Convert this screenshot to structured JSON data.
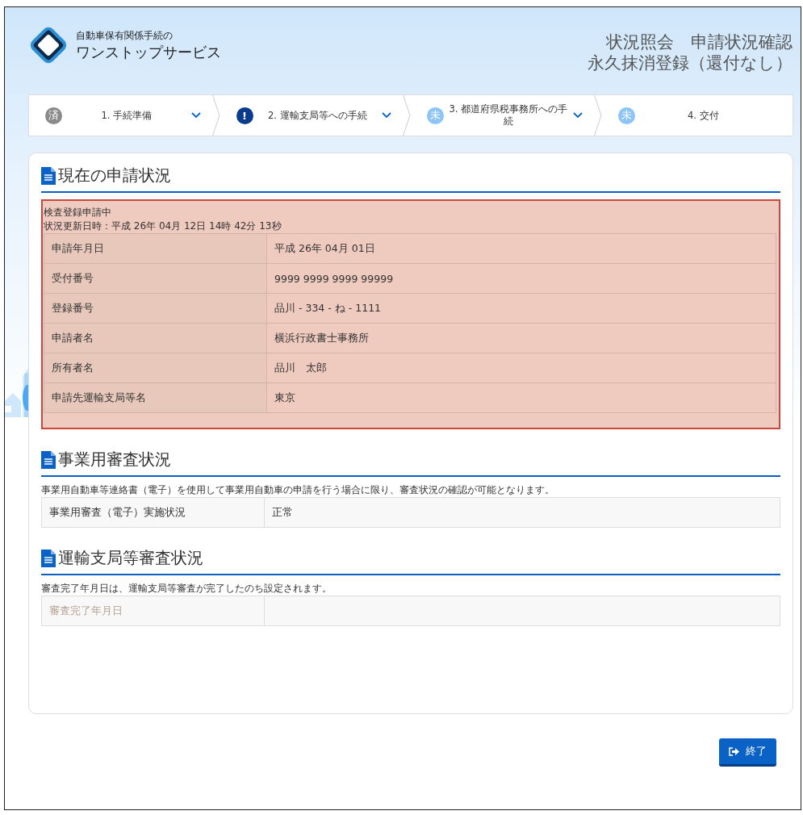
{
  "header": {
    "logo_caption": "自動車保有関係手続の",
    "logo_title": "ワンストップサービス",
    "page_title": [
      "状況照会　申請状況確認",
      "永久抹消登録（還付なし）"
    ]
  },
  "steps": [
    {
      "badge": "済",
      "kind": "done",
      "label": "1. 手続準備",
      "dropdown": true
    },
    {
      "badge": "!",
      "kind": "alert",
      "label": "2. 運輸支局等への手続",
      "dropdown": true
    },
    {
      "badge": "未",
      "kind": "pending",
      "label": "3. 都道府県税事務所への手続",
      "dropdown": true
    },
    {
      "badge": "未",
      "kind": "pending",
      "label": "4. 交付",
      "dropdown": false
    }
  ],
  "sections": [
    {
      "title": "現在の申請状況",
      "highlighted": true,
      "notes": [
        "検査登録申請中",
        "状況更新日時：平成 26年 04月 12日 14時 42分 13秒"
      ],
      "rows": [
        {
          "label": "申請年月日",
          "value": "平成 26年 04月 01日",
          "disabled": false
        },
        {
          "label": "受付番号",
          "value": "9999 9999 9999 99999",
          "disabled": false
        },
        {
          "label": "登録番号",
          "value": "品川 - 334 - ね - 1111",
          "disabled": false
        },
        {
          "label": "申請者名",
          "value": "横浜行政書士事務所",
          "disabled": false
        },
        {
          "label": "所有者名",
          "value": "品川　太郎",
          "disabled": false
        },
        {
          "label": "申請先運輸支局等名",
          "value": "東京",
          "disabled": false
        }
      ]
    },
    {
      "title": "事業用審査状況",
      "highlighted": false,
      "notes": [
        "事業用自動車等連絡書（電子）を使用して事業用自動車の申請を行う場合に限り、審査状況の確認が可能となります。"
      ],
      "rows": [
        {
          "label": "事業用審査（電子）実施状況",
          "value": "正常",
          "disabled": false
        }
      ]
    },
    {
      "title": "運輸支局等審査状況",
      "highlighted": false,
      "notes": [
        "審査完了年月日は、運輸支局等審査が完了したのち設定されます。"
      ],
      "rows": [
        {
          "label": "審査完了年月日",
          "value": "",
          "disabled": true
        }
      ]
    }
  ],
  "exit_button": "終了"
}
